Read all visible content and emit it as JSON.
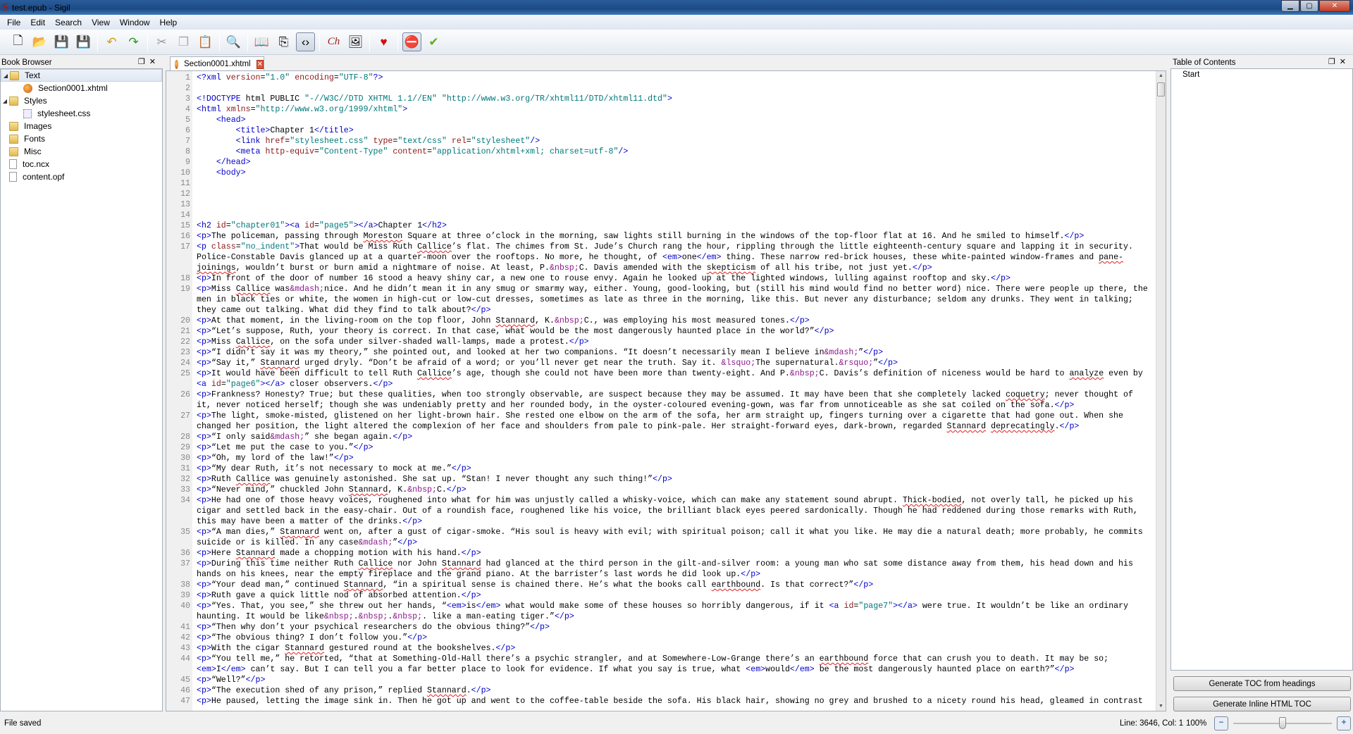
{
  "window": {
    "title": "test.epub - Sigil",
    "logo": "S"
  },
  "menu": [
    "File",
    "Edit",
    "Search",
    "View",
    "Window",
    "Help"
  ],
  "toolbar": [
    {
      "name": "new-file-icon",
      "g": "🗋"
    },
    {
      "name": "open-icon",
      "g": "📂"
    },
    {
      "name": "save-icon",
      "g": "💾"
    },
    {
      "name": "save-as-icon",
      "g": "💾"
    },
    "|",
    {
      "name": "undo-icon",
      "g": "↶",
      "c": "#d4a000"
    },
    {
      "name": "redo-icon",
      "g": "↷",
      "c": "#2a9a20"
    },
    "|",
    {
      "name": "cut-icon",
      "g": "✂",
      "c": "#999"
    },
    {
      "name": "copy-icon",
      "g": "❐",
      "c": "#aaa"
    },
    {
      "name": "paste-icon",
      "g": "📋"
    },
    "|",
    {
      "name": "find-replace-icon",
      "g": "🔍"
    },
    "|",
    {
      "name": "book-view-icon",
      "g": "📖"
    },
    {
      "name": "split-view-icon",
      "g": "⎘"
    },
    {
      "name": "code-view-icon",
      "g": "‹›",
      "on": true
    },
    "|",
    {
      "name": "spellcheck-icon",
      "g": "Ch",
      "c": "#a02020"
    },
    {
      "name": "insert-image-icon",
      "g": "🖼"
    },
    "|",
    {
      "name": "donate-heart-icon",
      "g": "♥",
      "c": "#d01010"
    },
    "|",
    {
      "name": "stop-icon",
      "g": "⛔",
      "c": "#d01010",
      "on": true
    },
    {
      "name": "validate-check-icon",
      "g": "✔",
      "c": "#5ab020"
    }
  ],
  "book_browser": {
    "title": "Book Browser",
    "items": [
      {
        "label": "Text",
        "type": "folder",
        "exp": true,
        "lvl": 0,
        "sel": true
      },
      {
        "label": "Section0001.xhtml",
        "type": "xhtml",
        "lvl": 1
      },
      {
        "label": "Styles",
        "type": "folder",
        "exp": true,
        "lvl": 0
      },
      {
        "label": "stylesheet.css",
        "type": "css",
        "lvl": 1
      },
      {
        "label": "Images",
        "type": "folder",
        "lvl": 0
      },
      {
        "label": "Fonts",
        "type": "folder",
        "lvl": 0
      },
      {
        "label": "Misc",
        "type": "folder",
        "lvl": 0
      },
      {
        "label": "toc.ncx",
        "type": "file",
        "lvl": 0
      },
      {
        "label": "content.opf",
        "type": "file",
        "lvl": 0
      }
    ]
  },
  "editor": {
    "tab": "Section0001.xhtml",
    "misspelled": [
      "Moreston",
      "Callice",
      "pane-",
      "joinings",
      "skepticism",
      "Stannard",
      "analyze",
      "coquetry",
      "deprecatingly",
      "Thick-bodied",
      "earthbound"
    ],
    "lines": [
      [
        "<?xml version=\"1.0\" encoding=\"UTF-8\"?>"
      ],
      [
        ""
      ],
      [
        "<!DOCTYPE html PUBLIC \"-//W3C//DTD XHTML 1.1//EN\" \"http://www.w3.org/TR/xhtml11/DTD/xhtml11.dtd\">"
      ],
      [
        "<html xmlns=\"http://www.w3.org/1999/xhtml\">"
      ],
      [
        "    <head>"
      ],
      [
        "        <title>Chapter 1</title>"
      ],
      [
        "        <link href=\"stylesheet.css\" type=\"text/css\" rel=\"stylesheet\"/>"
      ],
      [
        "        <meta http-equiv=\"Content-Type\" content=\"application/xhtml+xml; charset=utf-8\"/>"
      ],
      [
        "    </head>"
      ],
      [
        "    <body>"
      ],
      [
        ""
      ],
      [
        ""
      ],
      [
        ""
      ],
      [
        ""
      ],
      [
        "<h2 id=\"chapter01\"><a id=\"page5\"></a>Chapter 1</h2>"
      ],
      [
        "<p>The policeman, passing through Moreston Square at three o’clock in the morning, saw lights still burning in the windows of the top-floor flat at 16. And he smiled to himself.</p>"
      ],
      [
        "<p class=\"no_indent\">That would be Miss Ruth Callice’s flat. The chimes from St. Jude’s Church rang the hour, rippling through the little eighteenth-century square and lapping it in security.",
        "Police-Constable Davis glanced up at a quarter-moon over the rooftops. No more, he thought, of <em>one</em> thing. These narrow red-brick houses, these white-painted window-frames and pane-",
        "joinings, wouldn’t burst or burn amid a nightmare of noise. At least, P.&nbsp;C. Davis amended with the skepticism of all his tribe, not just yet.</p>"
      ],
      [
        "<p>In front of the door of number 16 stood a heavy shiny car, a new one to rouse envy. Again he looked up at the lighted windows, lulling against rooftop and sky.</p>"
      ],
      [
        "<p>Miss Callice was&mdash;nice. And he didn’t mean it in any smug or smarmy way, either. Young, good-looking, but (still his mind would find no better word) nice. There were people up there, the",
        "men in black ties or white, the women in high-cut or low-cut dresses, sometimes as late as three in the morning, like this. But never any disturbance; seldom any drunks. They went in talking;",
        "they came out talking. What did they find to talk about?</p>"
      ],
      [
        "<p>At that moment, in the living-room on the top floor, John Stannard, K.&nbsp;C., was employing his most measured tones.</p>"
      ],
      [
        "<p>“Let’s suppose, Ruth, your theory is correct. In that case, what would be the most dangerously haunted place in the world?”</p>"
      ],
      [
        "<p>Miss Callice, on the sofa under silver-shaded wall-lamps, made a protest.</p>"
      ],
      [
        "<p>“I didn’t say it was my theory,” she pointed out, and looked at her two companions. “It doesn’t necessarily mean I believe in&mdash;”</p>"
      ],
      [
        "<p>“Say it,” Stannard urged dryly. “Don’t be afraid of a word; or you’ll never get near the truth. Say it. &lsquo;The supernatural.&rsquo;”</p>"
      ],
      [
        "<p>It would have been difficult to tell Ruth Callice’s age, though she could not have been more than twenty-eight. And P.&nbsp;C. Davis’s definition of niceness would be hard to analyze even by",
        "<a id=\"page6\"></a> closer observers.</p>"
      ],
      [
        "<p>Frankness? Honesty? True; but these qualities, when too strongly observable, are suspect because they may be assumed. It may have been that she completely lacked coquetry; never thought of",
        "it, never noticed herself; though she was undeniably pretty and her rounded body, in the oyster-coloured evening-gown, was far from unnoticeable as she sat coiled on the sofa.</p>"
      ],
      [
        "<p>The light, smoke-misted, glistened on her light-brown hair. She rested one elbow on the arm of the sofa, her arm straight up, fingers turning over a cigarette that had gone out. When she",
        "changed her position, the light altered the complexion of her face and shoulders from pale to pink-pale. Her straight-forward eyes, dark-brown, regarded Stannard deprecatingly.</p>"
      ],
      [
        "<p>“I only said&mdash;” she began again.</p>"
      ],
      [
        "<p>“Let me put the case to you.”</p>"
      ],
      [
        "<p>“Oh, my lord of the law!”</p>"
      ],
      [
        "<p>“My dear Ruth, it’s not necessary to mock at me.”</p>"
      ],
      [
        "<p>Ruth Callice was genuinely astonished. She sat up. “Stan! I never thought any such thing!”</p>"
      ],
      [
        "<p>“Never mind,” chuckled John Stannard, K.&nbsp;C.</p>"
      ],
      [
        "<p>He had one of those heavy voices, roughened into what for him was unjustly called a whisky-voice, which can make any statement sound abrupt. Thick-bodied, not overly tall, he picked up his",
        "cigar and settled back in the easy-chair. Out of a roundish face, roughened like his voice, the brilliant black eyes peered sardonically. Though he had reddened during those remarks with Ruth,",
        "this may have been a matter of the drinks.</p>"
      ],
      [
        "<p>“A man dies,” Stannard went on, after a gust of cigar-smoke. “His soul is heavy with evil; with spiritual poison; call it what you like. He may die a natural death; more probably, he commits",
        "suicide or is killed. In any case&mdash;”</p>"
      ],
      [
        "<p>Here Stannard made a chopping motion with his hand.</p>"
      ],
      [
        "<p>During this time neither Ruth Callice nor John Stannard had glanced at the third person in the gilt-and-silver room: a young man who sat some distance away from them, his head down and his",
        "hands on his knees, near the empty fireplace and the grand piano. At the barrister’s last words he did look up.</p>"
      ],
      [
        "<p>“Your dead man,” continued Stannard, “in a spiritual sense is chained there. He’s what the books call earthbound. Is that correct?”</p>"
      ],
      [
        "<p>Ruth gave a quick little nod of absorbed attention.</p>"
      ],
      [
        "<p>“Yes. That, you see,” she threw out her hands, “<em>is</em> what would make some of these houses so horribly dangerous, if it <a id=\"page7\"></a> were true. It wouldn’t be like an ordinary",
        "haunting. It would be like&nbsp;.&nbsp;.&nbsp;. like a man-eating tiger.”</p>"
      ],
      [
        "<p>“Then why don’t your psychical researchers do the obvious thing?”</p>"
      ],
      [
        "<p>“The obvious thing? I don’t follow you.”</p>"
      ],
      [
        "<p>With the cigar Stannard gestured round at the bookshelves.</p>"
      ],
      [
        "<p>“You tell me,” he retorted, “that at Something-Old-Hall there’s a psychic strangler, and at Somewhere-Low-Grange there’s an earthbound force that can crush you to death. It may be so;",
        "<em>I</em> can’t say. But I can tell you a far better place to look for evidence. If what you say is true, what <em>would</em> be the most dangerously haunted place on earth?”</p>"
      ],
      [
        "<p>“Well?”</p>"
      ],
      [
        "<p>“The execution shed of any prison,” replied Stannard.</p>"
      ],
      [
        "<p>He paused, letting the image sink in. Then he got up and went to the coffee-table beside the sofa. His black hair, showing no grey and brushed to a nicety round his head, gleamed in contrast"
      ]
    ]
  },
  "toc": {
    "title": "Table of Contents",
    "items": [
      "Start"
    ],
    "gen_headings": "Generate TOC from headings",
    "gen_inline": "Generate Inline HTML TOC"
  },
  "status": {
    "message": "File saved",
    "position": "Line: 3646, Col: 1",
    "zoom": "100%",
    "zoom_level": 0.5
  }
}
